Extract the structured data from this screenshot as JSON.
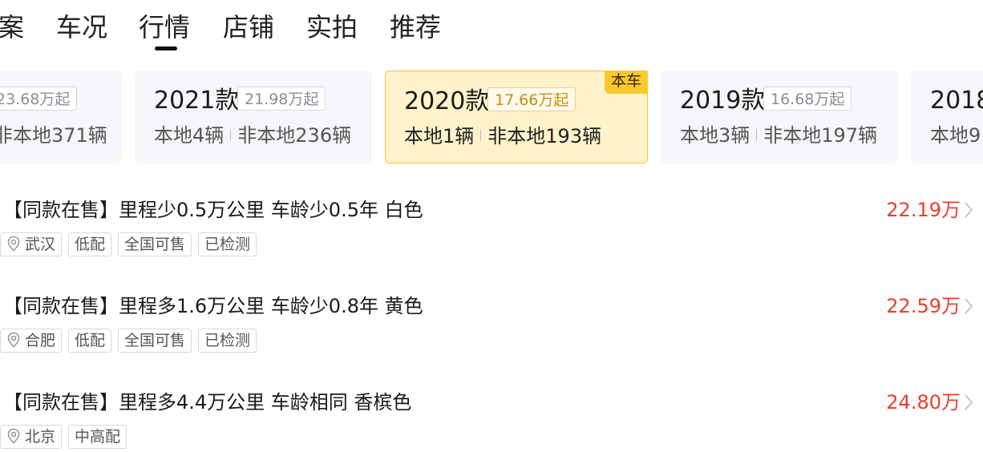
{
  "tabs": [
    {
      "label": "案"
    },
    {
      "label": "车况"
    },
    {
      "label": "行情"
    },
    {
      "label": "店铺"
    },
    {
      "label": "实拍"
    },
    {
      "label": "推荐"
    }
  ],
  "active_tab": "行情",
  "year_cards": [
    {
      "year": "",
      "price": "23.68万起",
      "local": "",
      "nonlocal": "非本地371辆"
    },
    {
      "year": "2021款",
      "price": "21.98万起",
      "local": "本地4辆",
      "nonlocal": "非本地236辆"
    },
    {
      "year": "2020款",
      "price": "17.66万起",
      "local": "本地1辆",
      "nonlocal": "非本地193辆",
      "badge": "本车"
    },
    {
      "year": "2019款",
      "price": "16.68万起",
      "local": "本地3辆",
      "nonlocal": "非本地197辆"
    },
    {
      "year": "2018",
      "price": "",
      "local": "本地9",
      "nonlocal": ""
    }
  ],
  "listings": [
    {
      "title": "【同款在售】里程少0.5万公里 车龄少0.5年 白色",
      "price": "22.19万",
      "location": "武汉",
      "tags": [
        "低配",
        "全国可售",
        "已检测"
      ]
    },
    {
      "title": "【同款在售】里程多1.6万公里 车龄少0.8年 黄色",
      "price": "22.59万",
      "location": "合肥",
      "tags": [
        "低配",
        "全国可售",
        "已检测"
      ]
    },
    {
      "title": "【同款在售】里程多4.4万公里 车龄相同 香槟色",
      "price": "24.80万",
      "location": "北京",
      "tags": [
        "中高配"
      ]
    }
  ],
  "colors": {
    "accent_price": "#e8402c",
    "active_card_bg": "#fff3cc",
    "active_card_border": "#f7c239",
    "badge_bg": "#fbc82f",
    "card_bg": "#f5f6f9"
  },
  "icons": {
    "tag_location": "location-pin-icon",
    "listing_arrow": "chevron-right-icon"
  }
}
